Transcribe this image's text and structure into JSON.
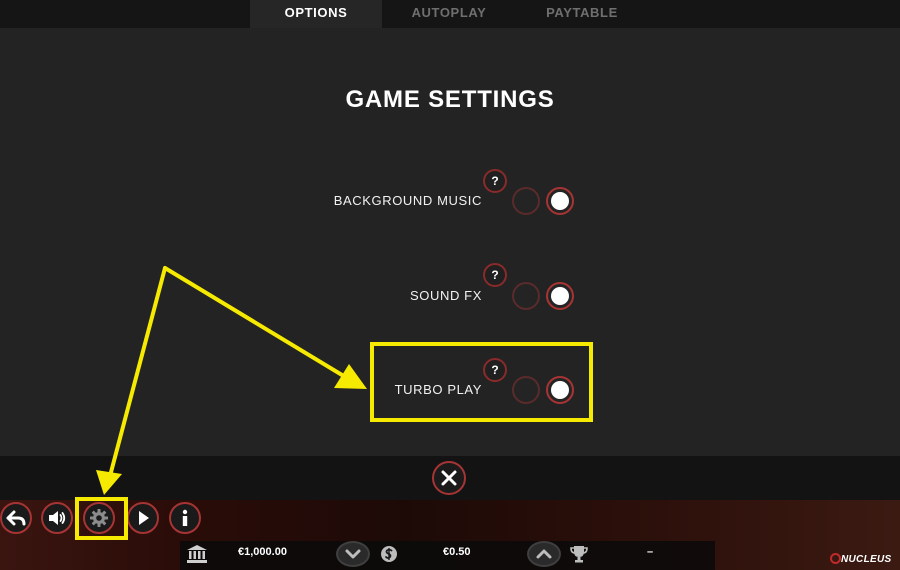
{
  "tabs": [
    {
      "label": "OPTIONS",
      "active": true
    },
    {
      "label": "AUTOPLAY",
      "active": false
    },
    {
      "label": "PAYTABLE",
      "active": false
    }
  ],
  "title": "GAME SETTINGS",
  "settings": [
    {
      "label": "BACKGROUND MUSIC",
      "help": "?",
      "enabled": true
    },
    {
      "label": "SOUND FX",
      "help": "?",
      "enabled": true
    },
    {
      "label": "TURBO PLAY",
      "help": "?",
      "enabled": true
    }
  ],
  "footer": {
    "balance": "€1,000.00",
    "bet": "€0.50",
    "win": "–",
    "logo": "NUCLEUS"
  },
  "colors": {
    "accent_red": "#a73434",
    "highlight_yellow": "#f6ea00"
  },
  "icons": [
    "back-icon",
    "speaker-icon",
    "gear-icon",
    "play-icon",
    "info-icon",
    "bank-icon",
    "coin-icon",
    "trophy-icon",
    "close-icon",
    "chevron-down-icon",
    "chevron-up-icon"
  ]
}
